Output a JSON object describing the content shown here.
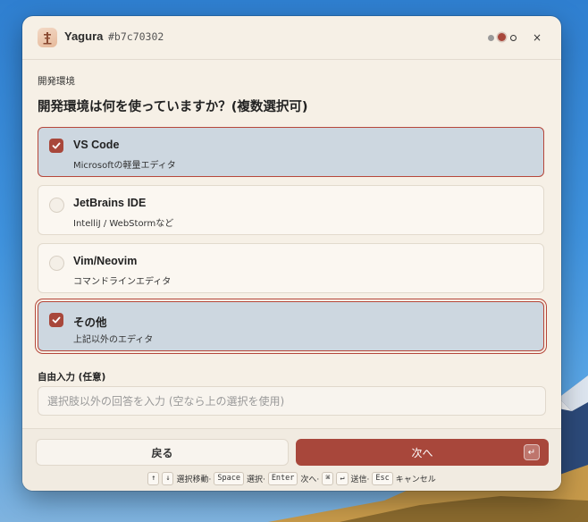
{
  "window": {
    "app_name": "Yagura",
    "hash": "#b7c70302",
    "close_glyph": "×"
  },
  "section_label": "開発環境",
  "question": "開発環境は何を使っていますか？(複数選択可)",
  "options": [
    {
      "title": "VS Code",
      "description": "Microsoftの軽量エディタ",
      "checked": true
    },
    {
      "title": "JetBrains IDE",
      "description": "IntelliJ / WebStormなど",
      "checked": false
    },
    {
      "title": "Vim/Neovim",
      "description": "コマンドラインエディタ",
      "checked": false
    },
    {
      "title": "その他",
      "description": "上記以外のエディタ",
      "checked": true
    }
  ],
  "free_input": {
    "label": "自由入力 (任意)",
    "placeholder": "選択肢以外の回答を入力 (空なら上の選択を使用)",
    "value": ""
  },
  "footer": {
    "back_label": "戻る",
    "next_label": "次へ",
    "enter_glyph": "↵",
    "shortcuts": {
      "up": "↑",
      "down": "↓",
      "move_text": "選択移動·",
      "space": "Space",
      "select_text": "選択·",
      "enter": "Enter",
      "next_text": "次へ·",
      "cmd": "⌘",
      "return": "↵",
      "send_text": "送信·",
      "esc": "Esc",
      "cancel_text": "キャンセル"
    }
  },
  "colors": {
    "accent": "#a8473b",
    "selected_bg": "#cdd7e0",
    "window_bg": "#f6f0e6"
  }
}
